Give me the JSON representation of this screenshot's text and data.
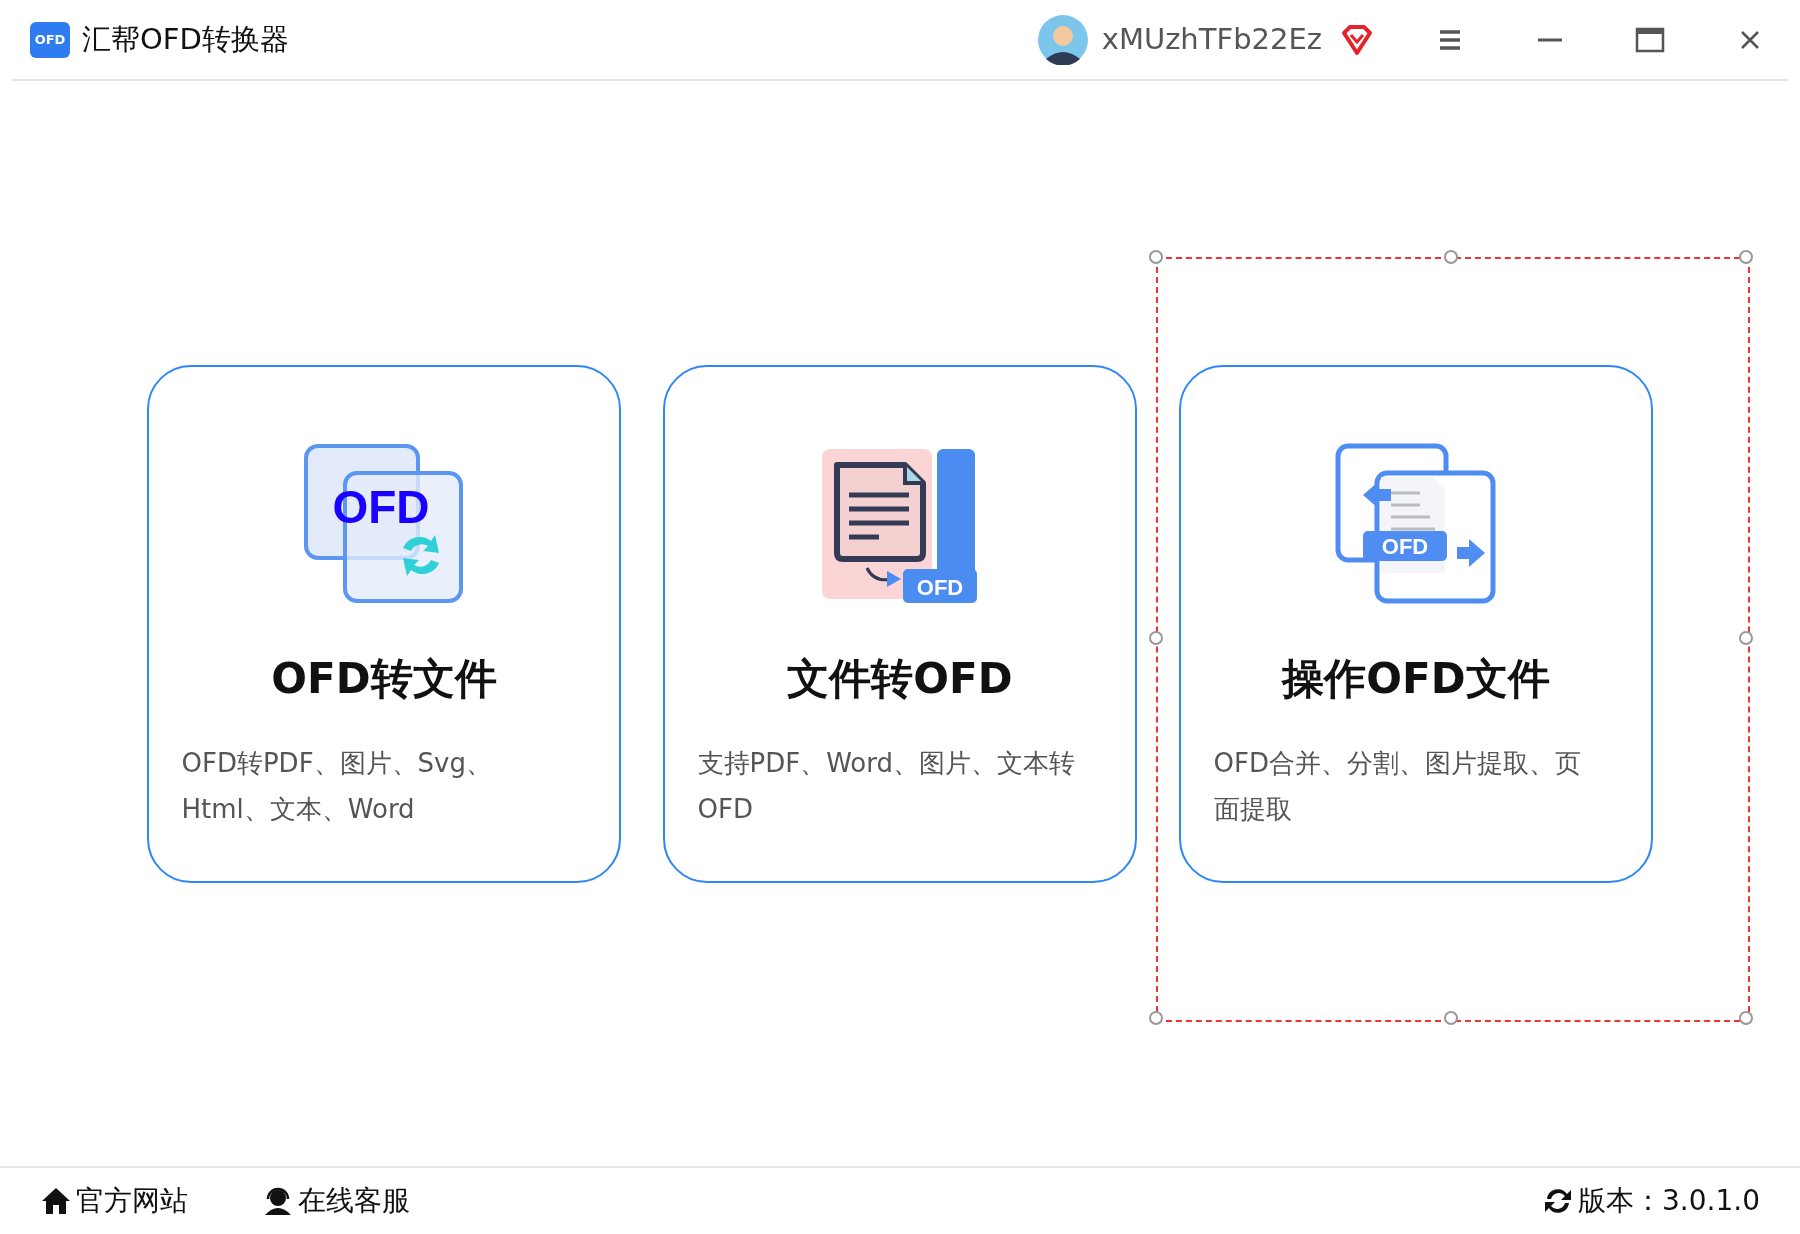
{
  "window": {
    "logo_text": "OFD",
    "title": "汇帮OFD转换器",
    "username": "xMUzhTFb22Ez"
  },
  "cards": [
    {
      "kind": "from-ofd",
      "icon_text": "OFD",
      "title": "OFD转文件",
      "description": "OFD转PDF、图片、Svg、Html、文本、Word"
    },
    {
      "kind": "to-ofd",
      "icon_text": "OFD",
      "title": "文件转OFD",
      "description": "支持PDF、Word、图片、文本转OFD"
    },
    {
      "kind": "operate",
      "icon_text": "OFD",
      "title": "操作OFD文件",
      "description": "OFD合并、分割、图片提取、页面提取"
    }
  ],
  "footer": {
    "links": [
      {
        "kind": "home",
        "label": "官方网站"
      },
      {
        "kind": "support",
        "label": "在线客服"
      }
    ],
    "version": "版本：3.0.1.0"
  }
}
